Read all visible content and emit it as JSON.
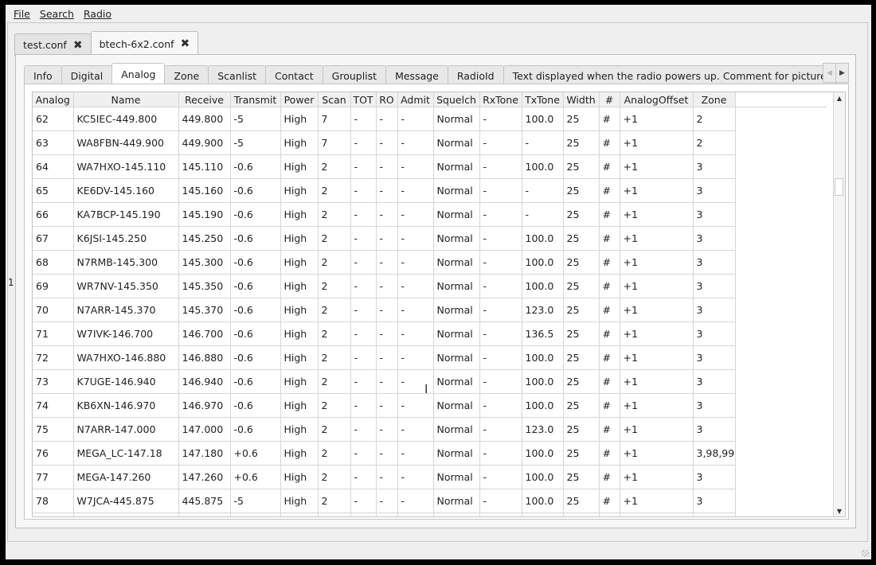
{
  "menubar": {
    "items": [
      "File",
      "Search",
      "Radio"
    ]
  },
  "file_tabs": [
    {
      "label": "test.conf",
      "active": false
    },
    {
      "label": "btech-6x2.conf",
      "active": true
    }
  ],
  "section_tabs": [
    "Info",
    "Digital",
    "Analog",
    "Zone",
    "Scanlist",
    "Contact",
    "Grouplist",
    "Message",
    "RadioId",
    "Text displayed when the radio powers up. Comment for picture",
    "("
  ],
  "active_section_tab": "Analog",
  "side_glyph": "1",
  "table": {
    "columns": [
      "Analog",
      "Name",
      "Receive",
      "Transmit",
      "Power",
      "Scan",
      "TOT",
      "RO",
      "Admit",
      "Squelch",
      "RxTone",
      "TxTone",
      "Width",
      "#",
      "AnalogOffset",
      "Zone"
    ],
    "rows": [
      [
        "62",
        "KC5IEC-449.800",
        "449.800",
        "-5",
        "High",
        "7",
        "-",
        "-",
        "-",
        "Normal",
        "-",
        "100.0",
        "25",
        "#",
        "+1",
        "2"
      ],
      [
        "63",
        "WA8FBN-449.900",
        "449.900",
        "-5",
        "High",
        "7",
        "-",
        "-",
        "-",
        "Normal",
        "-",
        "-",
        "25",
        "#",
        "+1",
        "2"
      ],
      [
        "64",
        "WA7HXO-145.110",
        "145.110",
        "-0.6",
        "High",
        "2",
        "-",
        "-",
        "-",
        "Normal",
        "-",
        "100.0",
        "25",
        "#",
        "+1",
        "3"
      ],
      [
        "65",
        "KE6DV-145.160",
        "145.160",
        "-0.6",
        "High",
        "2",
        "-",
        "-",
        "-",
        "Normal",
        "-",
        "-",
        "25",
        "#",
        "+1",
        "3"
      ],
      [
        "66",
        "KA7BCP-145.190",
        "145.190",
        "-0.6",
        "High",
        "2",
        "-",
        "-",
        "-",
        "Normal",
        "-",
        "-",
        "25",
        "#",
        "+1",
        "3"
      ],
      [
        "67",
        "K6JSI-145.250",
        "145.250",
        "-0.6",
        "High",
        "2",
        "-",
        "-",
        "-",
        "Normal",
        "-",
        "100.0",
        "25",
        "#",
        "+1",
        "3"
      ],
      [
        "68",
        "N7RMB-145.300",
        "145.300",
        "-0.6",
        "High",
        "2",
        "-",
        "-",
        "-",
        "Normal",
        "-",
        "100.0",
        "25",
        "#",
        "+1",
        "3"
      ],
      [
        "69",
        "WR7NV-145.350",
        "145.350",
        "-0.6",
        "High",
        "2",
        "-",
        "-",
        "-",
        "Normal",
        "-",
        "100.0",
        "25",
        "#",
        "+1",
        "3"
      ],
      [
        "70",
        "N7ARR-145.370",
        "145.370",
        "-0.6",
        "High",
        "2",
        "-",
        "-",
        "-",
        "Normal",
        "-",
        "123.0",
        "25",
        "#",
        "+1",
        "3"
      ],
      [
        "71",
        "W7IVK-146.700",
        "146.700",
        "-0.6",
        "High",
        "2",
        "-",
        "-",
        "-",
        "Normal",
        "-",
        "136.5",
        "25",
        "#",
        "+1",
        "3"
      ],
      [
        "72",
        "WA7HXO-146.880",
        "146.880",
        "-0.6",
        "High",
        "2",
        "-",
        "-",
        "-",
        "Normal",
        "-",
        "100.0",
        "25",
        "#",
        "+1",
        "3"
      ],
      [
        "73",
        "K7UGE-146.940",
        "146.940",
        "-0.6",
        "High",
        "2",
        "-",
        "-",
        "-",
        "Normal",
        "-",
        "100.0",
        "25",
        "#",
        "+1",
        "3"
      ],
      [
        "74",
        "KB6XN-146.970",
        "146.970",
        "-0.6",
        "High",
        "2",
        "-",
        "-",
        "-",
        "Normal",
        "-",
        "100.0",
        "25",
        "#",
        "+1",
        "3"
      ],
      [
        "75",
        "N7ARR-147.000",
        "147.000",
        "-0.6",
        "High",
        "2",
        "-",
        "-",
        "-",
        "Normal",
        "-",
        "123.0",
        "25",
        "#",
        "+1",
        "3"
      ],
      [
        "76",
        "MEGA_LC-147.18",
        "147.180",
        "+0.6",
        "High",
        "2",
        "-",
        "-",
        "-",
        "Normal",
        "-",
        "100.0",
        "25",
        "#",
        "+1",
        "3,98,99"
      ],
      [
        "77",
        "MEGA-147.260",
        "147.260",
        "+0.6",
        "High",
        "2",
        "-",
        "-",
        "-",
        "Normal",
        "-",
        "100.0",
        "25",
        "#",
        "+1",
        "3"
      ],
      [
        "78",
        "W7JCA-445.875",
        "445.875",
        "-5",
        "High",
        "2",
        "-",
        "-",
        "-",
        "Normal",
        "-",
        "100.0",
        "25",
        "#",
        "+1",
        "3"
      ],
      [
        "",
        "",
        "",
        "",
        "",
        "",
        "",
        "",
        "",
        "",
        "",
        "",
        "",
        "",
        "",
        ""
      ]
    ]
  }
}
